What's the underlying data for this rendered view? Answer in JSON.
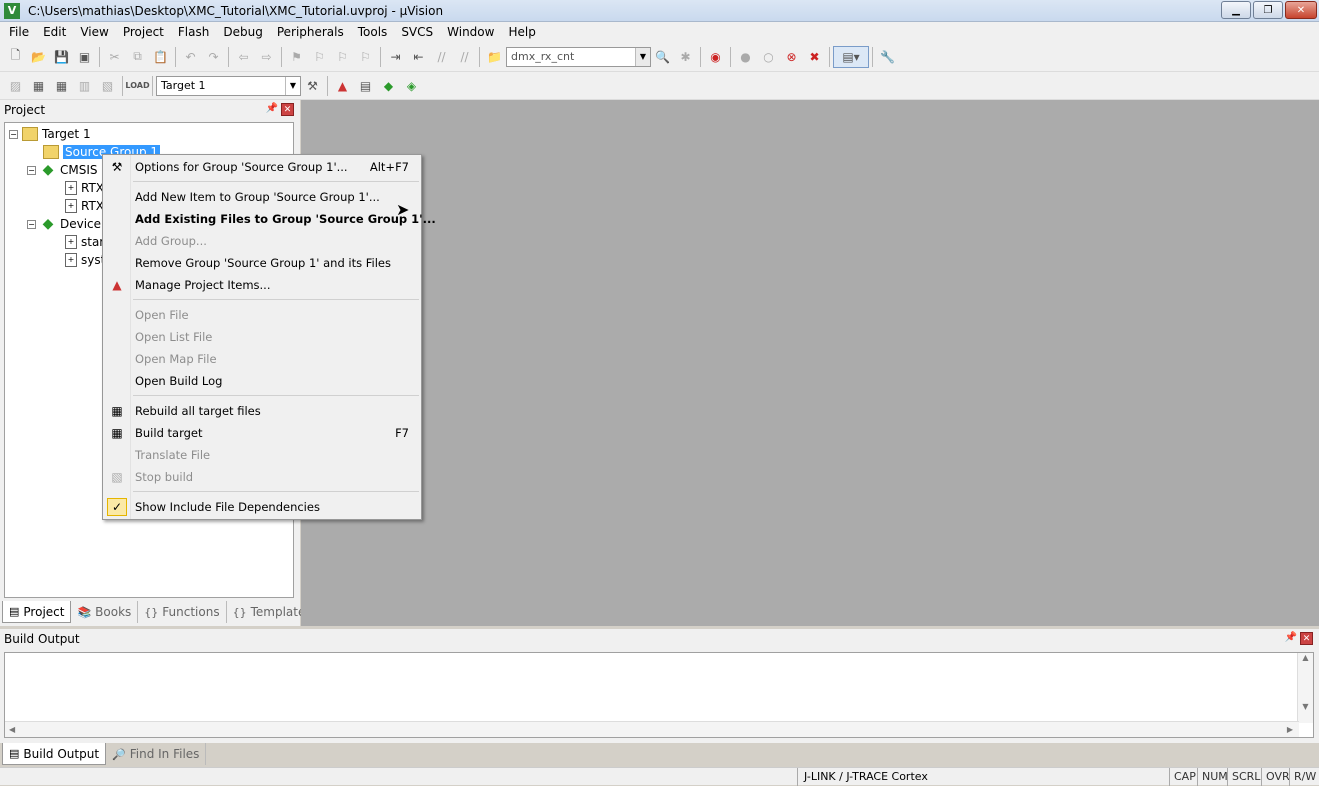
{
  "window": {
    "title": "C:\\Users\\mathias\\Desktop\\XMC_Tutorial\\XMC_Tutorial.uvproj - µVision",
    "app_icon_letter": "V"
  },
  "menubar": [
    "File",
    "Edit",
    "View",
    "Project",
    "Flash",
    "Debug",
    "Peripherals",
    "Tools",
    "SVCS",
    "Window",
    "Help"
  ],
  "toolbar1": {
    "find_combo": "dmx_rx_cnt"
  },
  "toolbar2": {
    "target_combo": "Target 1"
  },
  "project_panel": {
    "title": "Project",
    "tree": [
      {
        "label": "Target 1",
        "icon": "target-folder"
      },
      {
        "label": "Source Group 1",
        "icon": "folder",
        "selected": true
      },
      {
        "label": "CMSIS",
        "icon": "package"
      },
      {
        "label": "RTX",
        "icon": "file"
      },
      {
        "label": "RTX",
        "icon": "file"
      },
      {
        "label": "Device",
        "icon": "package"
      },
      {
        "label": "star",
        "icon": "file"
      },
      {
        "label": "syst",
        "icon": "file"
      }
    ],
    "tabs": [
      "Project",
      "Books",
      "Functions",
      "Templates"
    ]
  },
  "context_menu": {
    "items": [
      {
        "label": "Options for Group 'Source Group 1'...",
        "shortcut": "Alt+F7",
        "icon": "options-icon"
      },
      {
        "label": "Add New  Item to Group 'Source Group 1'..."
      },
      {
        "label": "Add Existing Files to Group 'Source Group 1'..."
      },
      {
        "label": "Add Group..."
      },
      {
        "label": "Remove Group 'Source Group 1' and its Files"
      },
      {
        "label": "Manage Project Items...",
        "icon": "manage-items-icon"
      },
      {
        "label": "Open File"
      },
      {
        "label": "Open List File"
      },
      {
        "label": "Open Map File"
      },
      {
        "label": "Open Build Log"
      },
      {
        "label": "Rebuild all target files",
        "icon": "rebuild-icon"
      },
      {
        "label": "Build target",
        "shortcut": "F7",
        "icon": "build-icon"
      },
      {
        "label": "Translate File"
      },
      {
        "label": "Stop build",
        "icon": "stop-build-icon"
      },
      {
        "label": "Show Include File Dependencies",
        "icon": "check-icon"
      }
    ]
  },
  "build_panel": {
    "title": "Build Output",
    "tabs": [
      "Build Output",
      "Find In Files"
    ]
  },
  "statusbar": {
    "debugger": "J-LINK / J-TRACE Cortex",
    "indicators": [
      "CAP",
      "NUM",
      "SCRL",
      "OVR",
      "R/W"
    ]
  }
}
